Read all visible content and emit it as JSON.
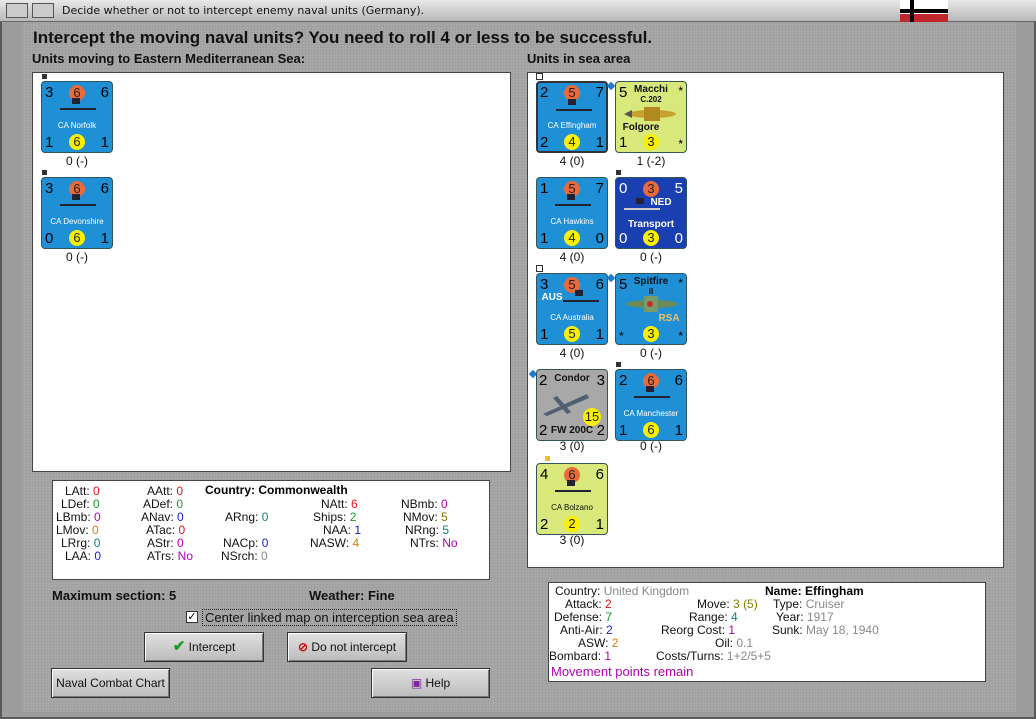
{
  "window": {
    "title": "Decide whether or not to intercept enemy naval units (Germany)."
  },
  "headline": "Intercept the moving naval units?  You need to roll 4 or less to be successful.",
  "left_label": "Units moving to Eastern Mediterranean Sea:",
  "right_label": "Units in sea area",
  "moving_units": [
    {
      "name": "CA Norfolk",
      "tl": "3",
      "tc": "6",
      "tr": "6",
      "bl": "1",
      "bc": "6",
      "br": "1",
      "status": "0 (-)"
    },
    {
      "name": "CA Devonshire",
      "tl": "3",
      "tc": "6",
      "tr": "6",
      "bl": "0",
      "bc": "6",
      "br": "1",
      "status": "0 (-)"
    }
  ],
  "sea_units": [
    {
      "name": "CA Effingham",
      "tl": "2",
      "tc": "5",
      "tr": "7",
      "bl": "2",
      "bc": "4",
      "br": "1",
      "status": "4 (0)"
    },
    {
      "name": "Folgore",
      "title": "Macchi",
      "sub": "C.202",
      "tl": "5",
      "tr": "*",
      "bl": "1",
      "bc": "3",
      "br": "*",
      "status": "1 (-2)"
    },
    {
      "name": "CA Hawkins",
      "tl": "1",
      "tc": "5",
      "tr": "7",
      "bl": "1",
      "bc": "4",
      "br": "0",
      "status": "4 (0)"
    },
    {
      "name": "Transport",
      "tag": "NED",
      "tl": "0",
      "tc": "3",
      "tr": "5",
      "bl": "0",
      "bc": "3",
      "br": "0",
      "status": "0 (-)"
    },
    {
      "name": "CA Australia",
      "tag": "AUS",
      "tl": "3",
      "tc": "5",
      "tr": "6",
      "bl": "1",
      "bc": "5",
      "br": "1",
      "status": "4 (0)"
    },
    {
      "name": "Spitfire",
      "sub": "II",
      "tag": "RSA",
      "tl": "5",
      "tr": "*",
      "bl": "*",
      "bc": "3",
      "br": "*",
      "status": "0 (-)"
    },
    {
      "name": "FW 200C",
      "title": "Condor",
      "tl": "2",
      "tr": "3",
      "bl": "2",
      "bc": "15",
      "br": "2",
      "status": "3 (0)"
    },
    {
      "name": "CA Manchester",
      "tl": "2",
      "tc": "6",
      "tr": "6",
      "bl": "1",
      "bc": "6",
      "br": "1",
      "status": "0 (-)"
    },
    {
      "name": "CA Bolzano",
      "tl": "4",
      "tc": "6",
      "tr": "6",
      "bl": "2",
      "bc": "2",
      "br": "1",
      "status": "3 (0)"
    }
  ],
  "stats": {
    "country_label": "Country:",
    "country": "Commonwealth",
    "LAtt": "0",
    "LDef": "0",
    "LBmb": "0",
    "LMov": "0",
    "LRrg": "0",
    "LAA": "0",
    "AAtt": "0",
    "ADef": "0",
    "ANav": "0",
    "ATac": "0",
    "AStr": "0",
    "ATrs": "No",
    "ARng": "0",
    "NAtt": "6",
    "Ships": "2",
    "NAA": "1",
    "NASW": "4",
    "NACp": "0",
    "NSrch": "0",
    "NBmb": "0",
    "NMov": "5",
    "NRng": "5",
    "NTrs": "No"
  },
  "maximum_section": "Maximum section: 5",
  "weather": "Weather:  Fine",
  "center_checkbox_label": "Center linked map on interception sea area",
  "buttons": {
    "intercept": "Intercept",
    "do_not_intercept": "Do not intercept",
    "naval_combat_chart": "Naval Combat Chart",
    "help": "Help"
  },
  "info": {
    "country_label": "Country:",
    "country": "United Kingdom",
    "name_label": "Name:",
    "name": "Effingham",
    "attack_label": "Attack:",
    "attack": "2",
    "defense_label": "Defense:",
    "defense": "7",
    "antiair_label": "Anti-Air:",
    "antiair": "2",
    "asw_label": "ASW:",
    "asw": "2",
    "bombard_label": "Bombard:",
    "bombard": "1",
    "move_label": "Move:",
    "move": "3",
    "move_extra": "(5)",
    "range_label": "Range:",
    "range": "4",
    "reorg_label": "Reorg Cost:",
    "reorg": "1",
    "oil_label": "Oil:",
    "oil": "0.1",
    "costs_label": "Costs/Turns:",
    "costs": "1+2/5+5",
    "type_label": "Type:",
    "type": "Cruiser",
    "year_label": "Year:",
    "year": "1917",
    "sunk_label": "Sunk:",
    "sunk": "May 18, 1940",
    "note": "Movement points remain"
  },
  "colors": {
    "counter_blue": "#1f8fd6",
    "counter_yellowgreen": "#d8e87a",
    "counter_gray": "#a8a8a8",
    "counter_darkblue": "#1a3fb0"
  }
}
